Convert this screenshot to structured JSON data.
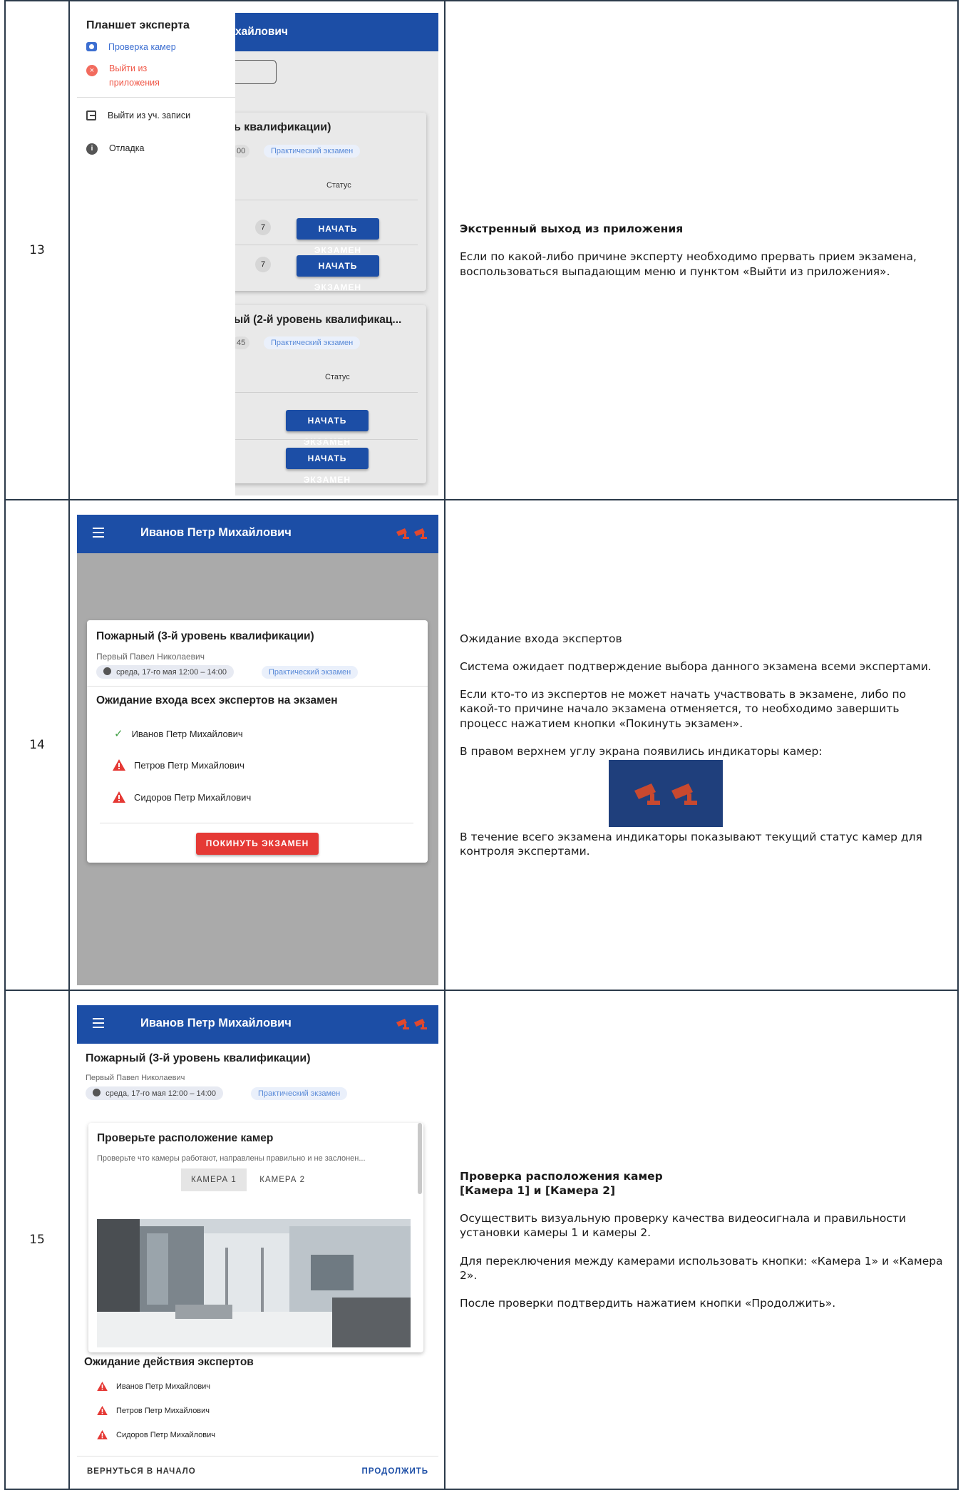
{
  "rows": [
    {
      "number": "13",
      "screen": {
        "background_title": "хайлович",
        "card1_title": "ь квалификации)",
        "card1_time_tail": "00",
        "chip_practical": "Практический экзамен",
        "status_header": "Статус",
        "count_badge": "7",
        "start_button": "НАЧАТЬ ЭКЗАМЕН",
        "card2_title": "ый (2-й уровень квалификац...",
        "card2_time_tail": "45",
        "drawer": {
          "title": "Планшет эксперта",
          "items": [
            {
              "label": "Проверка камер",
              "icon": "camera-icon",
              "color": "#3d6fd1"
            },
            {
              "label": "Выйти из приложения",
              "icon": "close-circle-icon",
              "color": "#f05545"
            },
            {
              "label": "Выйти из уч. записи",
              "icon": "logout-icon",
              "color": "#222222"
            },
            {
              "label": "Отладка",
              "icon": "info-icon",
              "color": "#222222"
            }
          ]
        }
      },
      "description": {
        "heading": "Экстренный выход из приложения",
        "paragraphs": [
          "Если по какой-либо причине эксперту необходимо прервать прием экзамена, воспользоваться выпадающим меню и пунктом «Выйти из приложения»."
        ]
      }
    },
    {
      "number": "14",
      "screen": {
        "appbar_title": "Иванов Петр Михайлович",
        "exam_title": "Пожарный (3-й уровень квалификации)",
        "examiner": "Первый Павел Николаевич",
        "datetime": "среда, 17-го мая 12:00 – 14:00",
        "chip_practical": "Практический экзамен",
        "waiting_title": "Ожидание входа всех экспертов на экзамен",
        "experts": [
          {
            "name": "Иванов Петр Михайлович",
            "status": "ok"
          },
          {
            "name": "Петров Петр Михайлович",
            "status": "warning"
          },
          {
            "name": "Сидоров Петр Михайлович",
            "status": "warning"
          }
        ],
        "leave_button": "ПОКИНУТЬ ЭКЗАМЕН"
      },
      "description": {
        "heading": "",
        "paragraphs": [
          "Ожидание входа экспертов",
          "Система ожидает подтверждение выбора данного экзамена всеми экспертами.",
          "Если кто-то из экспертов не может начать участвовать в экзамене, либо по какой-то причине начало экзамена отменяется, то необходимо завершить процесс нажатием кнопки «Покинуть экзамен».",
          "В правом верхнем углу экрана появились индикаторы камер:",
          "В течение всего экзамена индикаторы показывают текущий статус камер для контроля экспертами."
        ]
      }
    },
    {
      "number": "15",
      "screen": {
        "appbar_title": "Иванов Петр Михайлович",
        "exam_title": "Пожарный (3-й уровень квалификации)",
        "examiner": "Первый Павел Николаевич",
        "datetime": "среда, 17-го мая 12:00 – 14:00",
        "chip_practical": "Практический экзамен",
        "check_title": "Проверьте расположение камер",
        "check_subtitle": "Проверьте что камеры работают, направлены правильно и не заслонен...",
        "tabs": [
          "КАМЕРА 1",
          "КАМЕРА 2"
        ],
        "waiting_title": "Ожидание действия экспертов",
        "experts": [
          {
            "name": "Иванов Петр Михайлович",
            "status": "warning"
          },
          {
            "name": "Петров Петр Михайлович",
            "status": "warning"
          },
          {
            "name": "Сидоров Петр Михайлович",
            "status": "warning"
          }
        ],
        "back_button": "ВЕРНУТЬСЯ В НАЧАЛО",
        "continue_button": "ПРОДОЛЖИТЬ"
      },
      "description": {
        "heading": "Проверка расположения камер",
        "heading2": "[Камера 1] и [Камера 2]",
        "paragraphs": [
          "Осуществить визуальную проверку качества видеосигнала и правильности установки камеры 1 и камеры 2.",
          "Для переключения между камерами использовать кнопки: «Камера 1» и «Камера 2».",
          "После проверки подтвердить нажатием кнопки «Продолжить»."
        ]
      }
    }
  ],
  "colors": {
    "appbar": "#1c4ea6",
    "camera_indicator": "#e0482e",
    "warning": "#e53935",
    "ok": "#43a047",
    "link": "#1c4ea6"
  }
}
